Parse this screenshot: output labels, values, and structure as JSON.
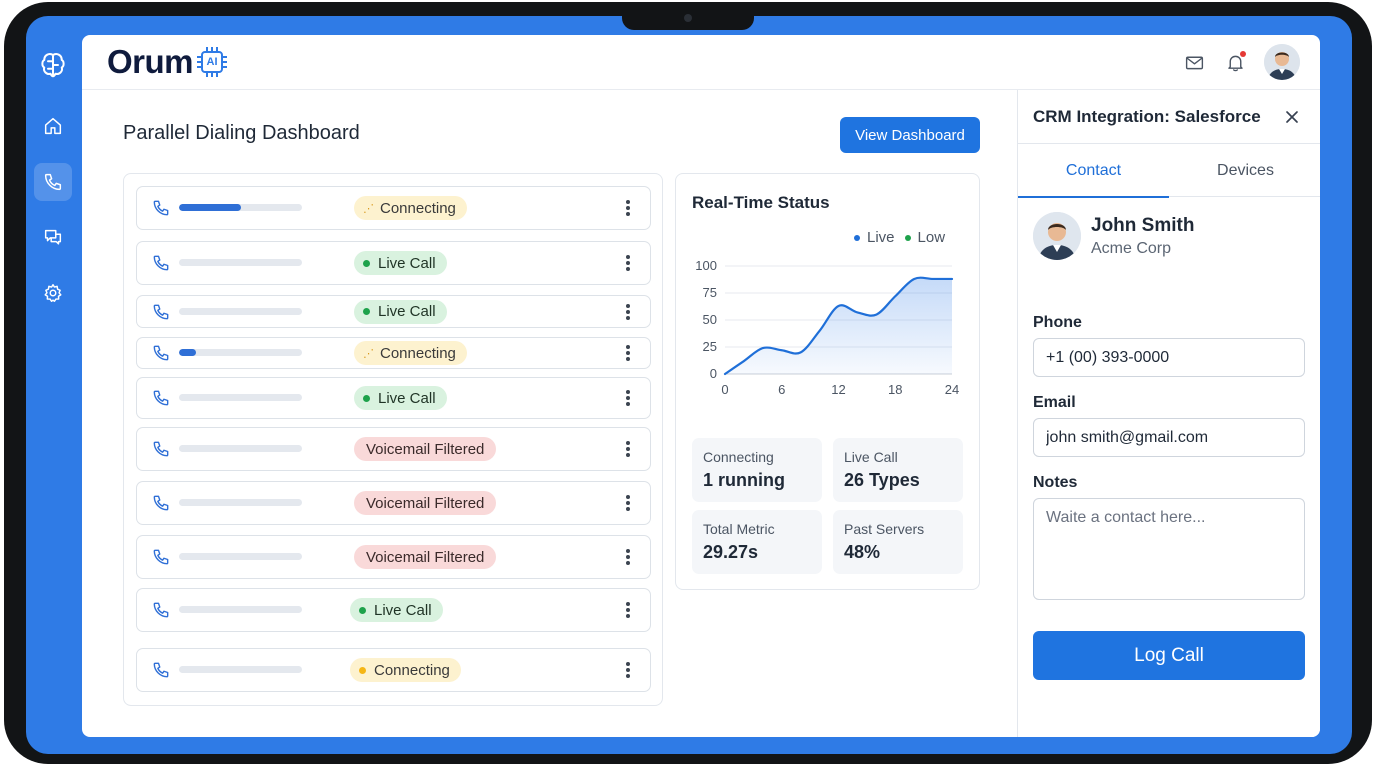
{
  "app": {
    "logo_text": "Orum",
    "logo_badge": "AI"
  },
  "nav": {
    "items": [
      {
        "name": "home",
        "icon": "home-icon",
        "active": false
      },
      {
        "name": "calls",
        "icon": "phone-icon",
        "active": true
      },
      {
        "name": "messages",
        "icon": "chat-icon",
        "active": false
      },
      {
        "name": "settings",
        "icon": "gear-icon",
        "active": false
      }
    ]
  },
  "header": {
    "icons": [
      "mail-icon",
      "bell-icon"
    ],
    "has_notification": true
  },
  "main": {
    "title": "Parallel Dialing Dashboard",
    "view_button": "View Dashboard",
    "calls": [
      {
        "status": "Connecting",
        "kind": "connecting",
        "progress": 0.5,
        "glyph": "⋰"
      },
      {
        "status": "Live Call",
        "kind": "live",
        "progress": 0
      },
      {
        "status": "Live Call",
        "kind": "live",
        "progress": 0
      },
      {
        "status": "Connecting",
        "kind": "connecting",
        "progress": 0.14,
        "glyph": "⋰"
      },
      {
        "status": "Live Call",
        "kind": "live",
        "progress": 0
      },
      {
        "status": "Voicemail Filtered",
        "kind": "voicemail",
        "progress": 0
      },
      {
        "status": "Voicemail Filtered",
        "kind": "voicemail",
        "progress": 0
      },
      {
        "status": "Voicemail Filtered",
        "kind": "voicemail",
        "progress": 0
      },
      {
        "status": "Live Call",
        "kind": "live",
        "progress": 0
      },
      {
        "status": "Connecting",
        "kind": "connecting-dot",
        "progress": 0
      }
    ]
  },
  "status": {
    "title": "Real-Time Status",
    "legend": [
      {
        "label": "Live",
        "color": "#1f6fd8"
      },
      {
        "label": "Low",
        "color": "#1ea24b"
      }
    ],
    "metrics": [
      {
        "label": "Connecting",
        "value": "1 running"
      },
      {
        "label": "Live Call",
        "value": "26 Types"
      },
      {
        "label": "Total Metric",
        "value": "29.27s"
      },
      {
        "label": "Past Servers",
        "value": "48%"
      }
    ]
  },
  "chart_data": {
    "type": "area",
    "x": [
      0,
      2,
      4,
      6,
      8,
      10,
      12,
      14,
      16,
      18,
      20,
      22,
      24
    ],
    "series": [
      {
        "name": "Live",
        "values": [
          0,
          12,
          24,
          22,
          20,
          40,
          63,
          57,
          55,
          72,
          88,
          88,
          88
        ]
      }
    ],
    "xticks": [
      "0",
      "6",
      "12",
      "18",
      "24"
    ],
    "yticks": [
      "100",
      "75",
      "50",
      "25",
      "0"
    ],
    "xlim": [
      0,
      24
    ],
    "ylim": [
      0,
      100
    ],
    "grid": "horizontal",
    "legend": "top-right",
    "color": "#1f6fd8"
  },
  "crm": {
    "title": "CRM Integration: Salesforce",
    "tabs": [
      "Contact",
      "Devices"
    ],
    "active_tab": "Contact",
    "contact": {
      "name": "John Smith",
      "company": "Acme Corp"
    },
    "phone_label": "Phone",
    "phone_value": "+1 (00) 393-0000",
    "email_label": "Email",
    "email_value": "john smith@gmail.com",
    "notes_label": "Notes",
    "notes_placeholder": "Waite a contact here...",
    "log_button": "Log Call"
  }
}
